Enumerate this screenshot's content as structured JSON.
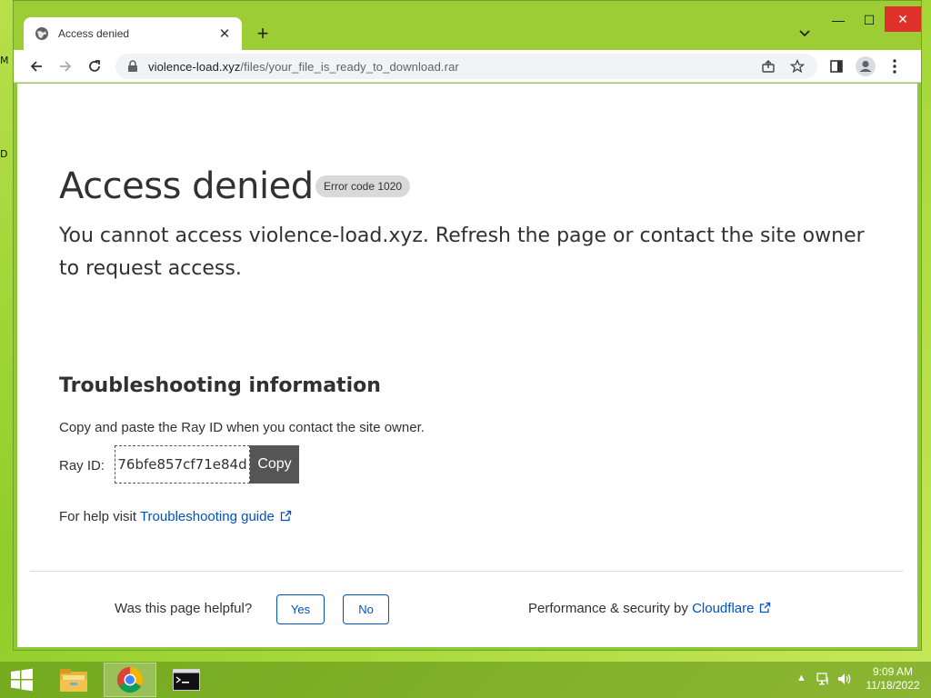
{
  "desktop": {
    "fragments": [
      "M",
      "D"
    ]
  },
  "browser": {
    "tab": {
      "title": "Access denied",
      "close_glyph": "✕",
      "icon": "globe-icon"
    },
    "new_tab_glyph": "+",
    "window_controls": {
      "minimize": "—",
      "maximize": "☐",
      "close": "✕"
    },
    "address": {
      "domain": "violence-load.xyz",
      "path": "/files/your_file_is_ready_to_download.rar"
    }
  },
  "page": {
    "title": "Access denied",
    "error_badge": "Error code 1020",
    "lead": "You cannot access violence-load.xyz. Refresh the page or contact the site owner to request access.",
    "troubleshooting_heading": "Troubleshooting information",
    "copy_instruction": "Copy and paste the Ray ID when you contact the site owner.",
    "ray_label": "Ray ID:",
    "ray_id": "76bfe857cf71e84d",
    "copy_button": "Copy",
    "help_prefix": "For help visit ",
    "help_link": "Troubleshooting guide",
    "helpful_question": "Was this page helpful?",
    "yes_button": "Yes",
    "no_button": "No",
    "perf_prefix": "Performance & security by ",
    "perf_link": "Cloudflare"
  },
  "taskbar": {
    "clock_time": "9:09 AM",
    "clock_date": "11/18/2022",
    "tray_chevron": "▲"
  },
  "colors": {
    "link": "#0051c3",
    "close_button": "#e0302a",
    "copy_button": "#555555"
  }
}
